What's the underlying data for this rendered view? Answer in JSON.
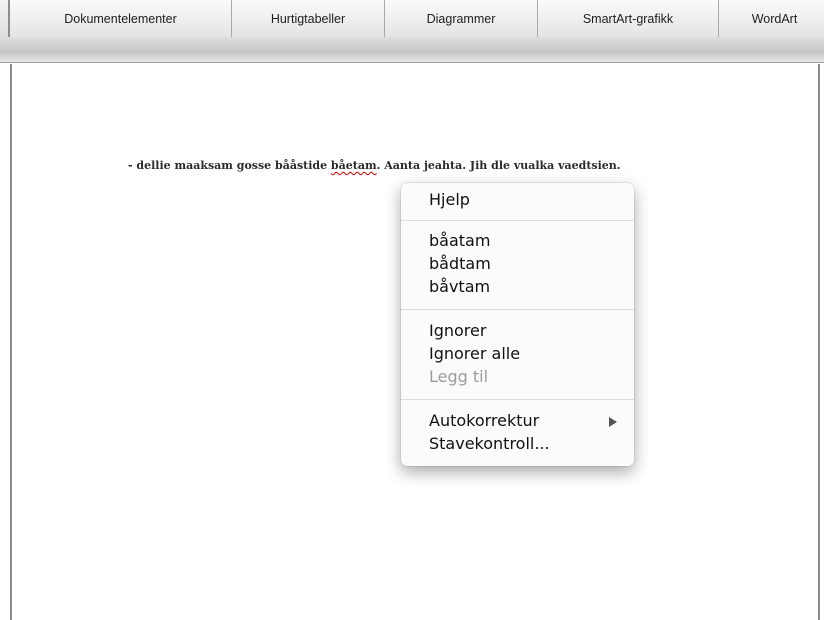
{
  "ribbon": {
    "tabs": [
      {
        "label": "Dokumentelementer"
      },
      {
        "label": "Hurtigtabeller"
      },
      {
        "label": "Diagrammer"
      },
      {
        "label": "SmartArt-grafikk"
      },
      {
        "label": "WordArt"
      }
    ]
  },
  "document": {
    "text_before": "- dellie maaksam gosse bååstide ",
    "misspelled_word": "båetam",
    "text_after": ". Aanta jeahta. Jih dle vualka vaedtsien."
  },
  "context_menu": {
    "help": "Hjelp",
    "suggestions": [
      "båatam",
      "bådtam",
      "båvtam"
    ],
    "ignore": "Ignorer",
    "ignore_all": "Ignorer alle",
    "add": "Legg til",
    "autocorrect": "Autokorrektur",
    "spellcheck": "Stavekontroll...",
    "add_enabled": false,
    "submenu_arrow_icon": "triangle-right-icon"
  },
  "colors": {
    "misspelling_underline": "#d00000",
    "disabled_text": "#9c9c9c"
  }
}
